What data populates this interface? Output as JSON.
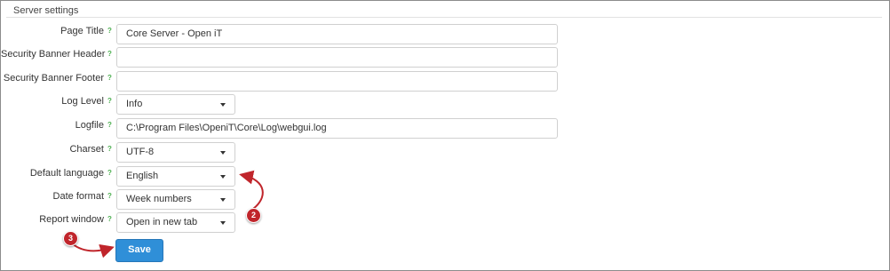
{
  "section": {
    "title": "Server settings"
  },
  "help_mark": "?",
  "fields": {
    "page_title": {
      "label": "Page Title",
      "value": "Core Server - Open iT"
    },
    "security_banner_header": {
      "label": "Security Banner Header",
      "value": ""
    },
    "security_banner_footer": {
      "label": "Security Banner Footer",
      "value": ""
    },
    "log_level": {
      "label": "Log Level",
      "value": "Info"
    },
    "logfile": {
      "label": "Logfile",
      "value": "C:\\Program Files\\OpeniT\\Core\\Log\\webgui.log"
    },
    "charset": {
      "label": "Charset",
      "value": "UTF-8"
    },
    "default_language": {
      "label": "Default language",
      "value": "English"
    },
    "date_format": {
      "label": "Date format",
      "value": "Week numbers"
    },
    "report_window": {
      "label": "Report window",
      "value": "Open in new tab"
    }
  },
  "save_button": {
    "label": "Save"
  },
  "callouts": {
    "two": "2",
    "three": "3"
  },
  "colors": {
    "accent": "#2f8fd8",
    "callout": "#c0252b",
    "help": "#4caf50"
  }
}
